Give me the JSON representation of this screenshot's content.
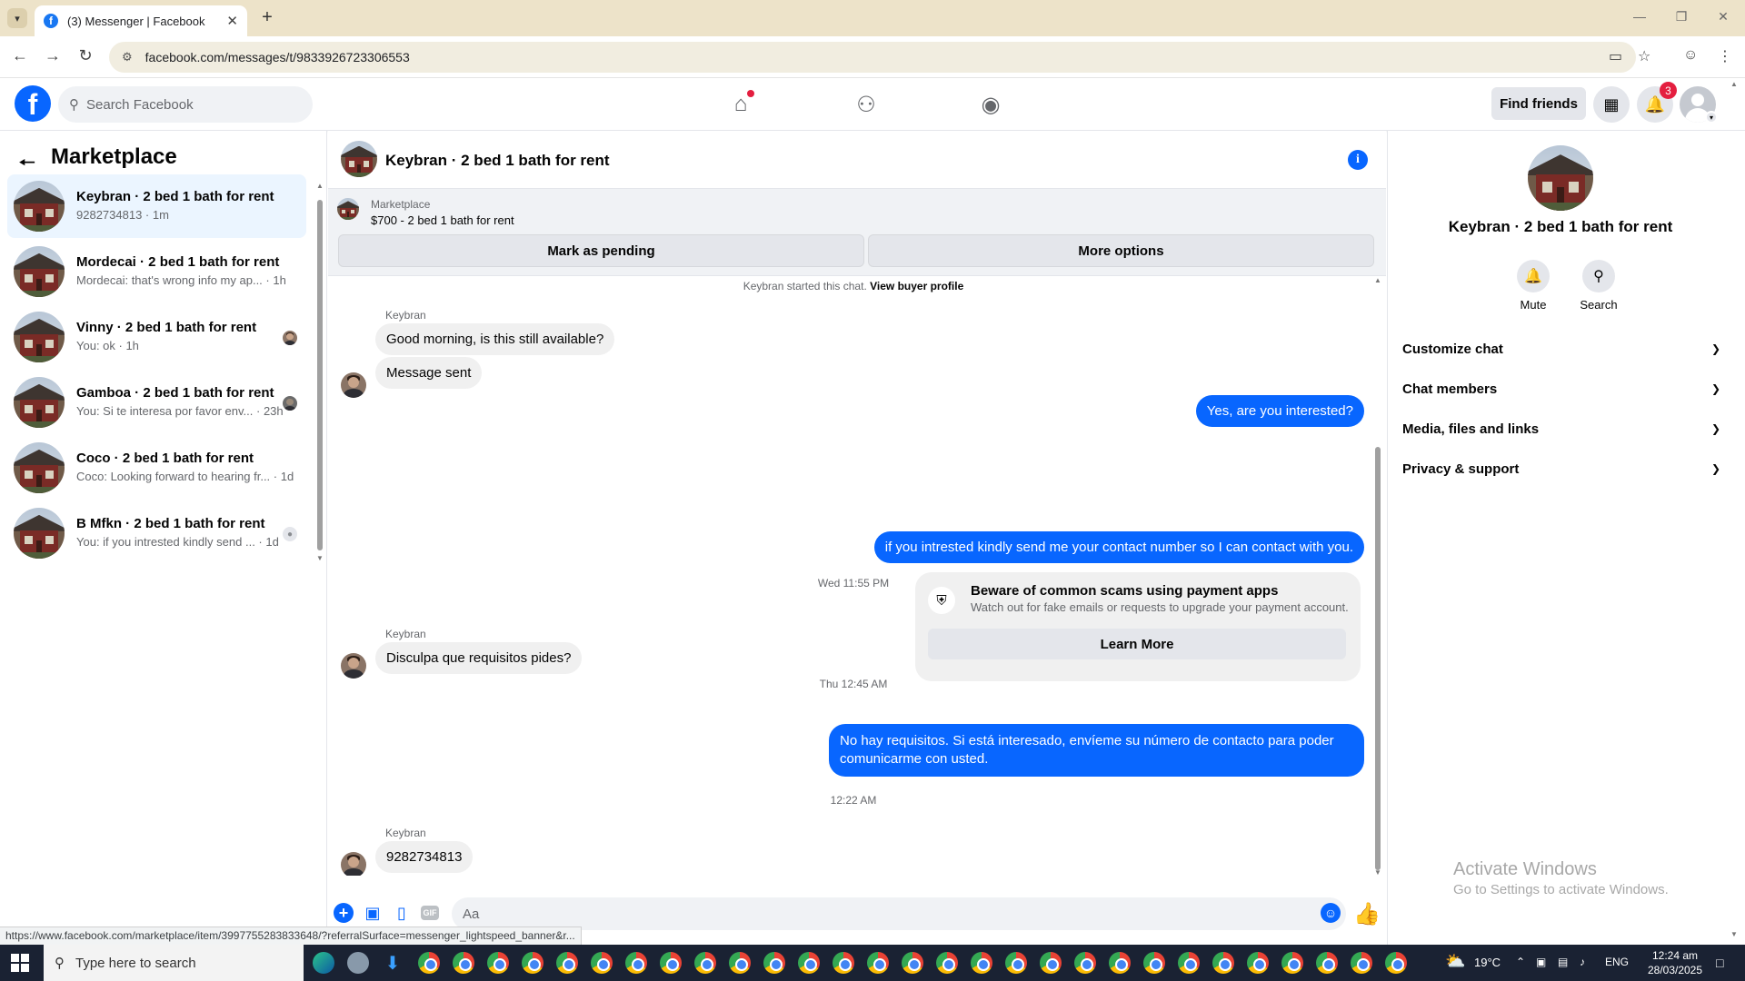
{
  "browser": {
    "tab_title": "(3) Messenger | Facebook",
    "url": "facebook.com/messages/t/9833926723306553",
    "status_url": "https://www.facebook.com/marketplace/item/3997755283833648/?referralSurface=messenger_lightspeed_banner&r..."
  },
  "fb": {
    "search_placeholder": "Search Facebook",
    "find_friends": "Find friends",
    "notification_count": "3"
  },
  "left_panel": {
    "title": "Marketplace",
    "conversations": [
      {
        "name": "Keybran · 2 bed 1 bath for rent",
        "preview": "9282734813 · 1m"
      },
      {
        "name": "Mordecai · 2 bed 1 bath for rent",
        "preview": "Mordecai: that's wrong info my ap... · 1h"
      },
      {
        "name": "Vinny · 2 bed 1 bath for rent",
        "preview": "You: ok · 1h"
      },
      {
        "name": "Gamboa · 2 bed 1 bath for rent",
        "preview": "You: Si te interesa por favor env... · 23h"
      },
      {
        "name": "Coco · 2 bed 1 bath for rent",
        "preview": "Coco: Looking forward to hearing fr... · 1d"
      },
      {
        "name": "B Mfkn · 2 bed 1 bath for rent",
        "preview": "You: if you intrested kindly send ... · 1d"
      }
    ]
  },
  "chat": {
    "title": "Keybran · 2 bed 1 bath for rent",
    "banner_label": "Marketplace",
    "banner_item": "$700 - 2 bed 1 bath for rent",
    "mark_pending": "Mark as pending",
    "more_options": "More options",
    "started_text": "Keybran started this chat.",
    "view_buyer_profile": "View buyer profile",
    "sender_name": "Keybran",
    "msg1": "Good morning, is this still available?",
    "msg2": "Message sent",
    "msg3": "Yes, are you interested?",
    "scam_title": "Beware of common scams using payment apps",
    "scam_sub": "Watch out for fake emails or requests to upgrade your payment account.",
    "learn_more": "Learn More",
    "msg4": "if you intrested kindly send me your contact number so I can contact with you.",
    "ts1": "Wed 11:55 PM",
    "msg5": "Disculpa que requisitos pides?",
    "ts2": "Thu 12:45 AM",
    "msg6": "No hay requisitos. Si está interesado, envíeme su número de contacto para poder comunicarme con usted.",
    "ts3": "12:22 AM",
    "msg7": "9282734813",
    "composer_placeholder": "Aa"
  },
  "right_panel": {
    "name": "Keybran · 2 bed 1 bath for rent",
    "mute": "Mute",
    "search": "Search",
    "sections": [
      "Customize chat",
      "Chat members",
      "Media, files and links",
      "Privacy & support"
    ]
  },
  "windows": {
    "activate_title": "Activate Windows",
    "activate_sub": "Go to Settings to activate Windows.",
    "search_placeholder": "Type here to search",
    "temperature": "19°C",
    "language": "ENG",
    "time": "12:24 am",
    "date": "28/03/2025"
  },
  "colors": {
    "fb_blue": "#0866ff",
    "bubble_in": "#f0f0f0",
    "active_row": "#ebf5ff"
  }
}
